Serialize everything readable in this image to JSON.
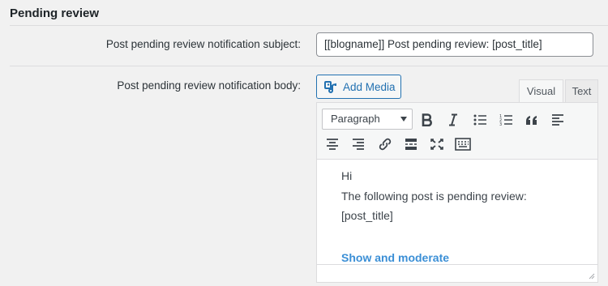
{
  "section": {
    "title": "Pending review"
  },
  "subject_row": {
    "label": "Post pending review notification subject:",
    "value": "[[blogname]] Post pending review: [post_title]"
  },
  "body_row": {
    "label": "Post pending review notification body:"
  },
  "editor": {
    "add_media_label": "Add Media",
    "tabs": {
      "visual": "Visual",
      "text": "Text"
    },
    "format_select": "Paragraph",
    "toolbar_icons": [
      "bold-icon",
      "italic-icon",
      "bullet-list-icon",
      "numbered-list-icon",
      "blockquote-icon",
      "align-left-icon",
      "align-center-icon",
      "align-right-icon",
      "link-icon",
      "read-more-icon",
      "fullscreen-icon",
      "toolbar-toggle-icon"
    ],
    "content": {
      "line1": "Hi",
      "line2": "The following post is pending review:",
      "line3": "[post_title]",
      "link": "Show and moderate"
    }
  },
  "colors": {
    "background": "#f1f1f1",
    "link": "#3b8fd6",
    "button_blue": "#2271b1"
  }
}
